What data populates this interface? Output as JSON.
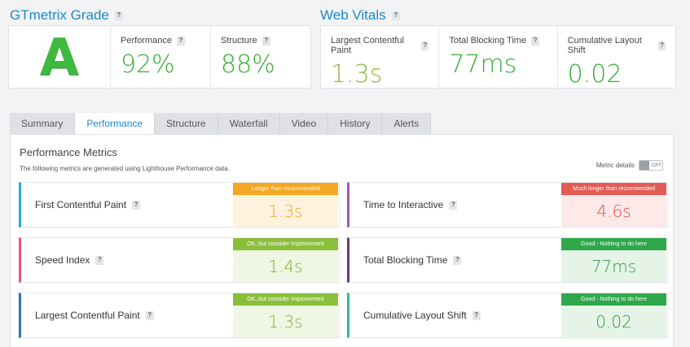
{
  "grade_section": {
    "title": "GTmetrix Grade",
    "help": "?",
    "grade": "A",
    "performance": {
      "label": "Performance",
      "value": "92%"
    },
    "structure": {
      "label": "Structure",
      "value": "88%"
    }
  },
  "web_vitals": {
    "title": "Web Vitals",
    "help": "?",
    "items": [
      {
        "label": "Largest Contentful Paint",
        "value": "1.3s"
      },
      {
        "label": "Total Blocking Time",
        "value": "77ms"
      },
      {
        "label": "Cumulative Layout Shift",
        "value": "0.02"
      }
    ]
  },
  "tabs": [
    "Summary",
    "Performance",
    "Structure",
    "Waterfall",
    "Video",
    "History",
    "Alerts"
  ],
  "active_tab": "Performance",
  "performance_metrics": {
    "title": "Performance Metrics",
    "subtitle": "The following metrics are generated using Lighthouse Performance data.",
    "metric_details_label": "Metric details",
    "toggle_state": "OFF",
    "metrics": [
      {
        "name": "First Contentful Paint",
        "badge": "Longer than recommended",
        "value": "1.3s",
        "accent": "#29a8dc",
        "badge_color": "#f5a623",
        "value_bg": "#fff3de",
        "value_color": "#f0a030"
      },
      {
        "name": "Time to Interactive",
        "badge": "Much longer than recommended",
        "value": "4.6s",
        "accent": "#9b59b6",
        "badge_color": "#e35b55",
        "value_bg": "#fde9e8",
        "value_color": "#e04a44"
      },
      {
        "name": "Speed Index",
        "badge": "OK, but consider improvement",
        "value": "1.4s",
        "accent": "#e8508a",
        "badge_color": "#8bbf3a",
        "value_bg": "#eff6e3",
        "value_color": "#7fae30"
      },
      {
        "name": "Total Blocking Time",
        "badge": "Good - Nothing to do here",
        "value": "77ms",
        "accent": "#6a3b7b",
        "badge_color": "#2ea84a",
        "value_bg": "#e6f4e8",
        "value_color": "#2a9a3f"
      },
      {
        "name": "Largest Contentful Paint",
        "badge": "OK, but consider improvement",
        "value": "1.3s",
        "accent": "#2f6fbd",
        "badge_color": "#8bbf3a",
        "value_bg": "#eff6e3",
        "value_color": "#7fae30"
      },
      {
        "name": "Cumulative Layout Shift",
        "badge": "Good - Nothing to do here",
        "value": "0.02",
        "accent": "#34b89a",
        "badge_color": "#2ea84a",
        "value_bg": "#e6f4e8",
        "value_color": "#2a9a3f"
      }
    ]
  }
}
